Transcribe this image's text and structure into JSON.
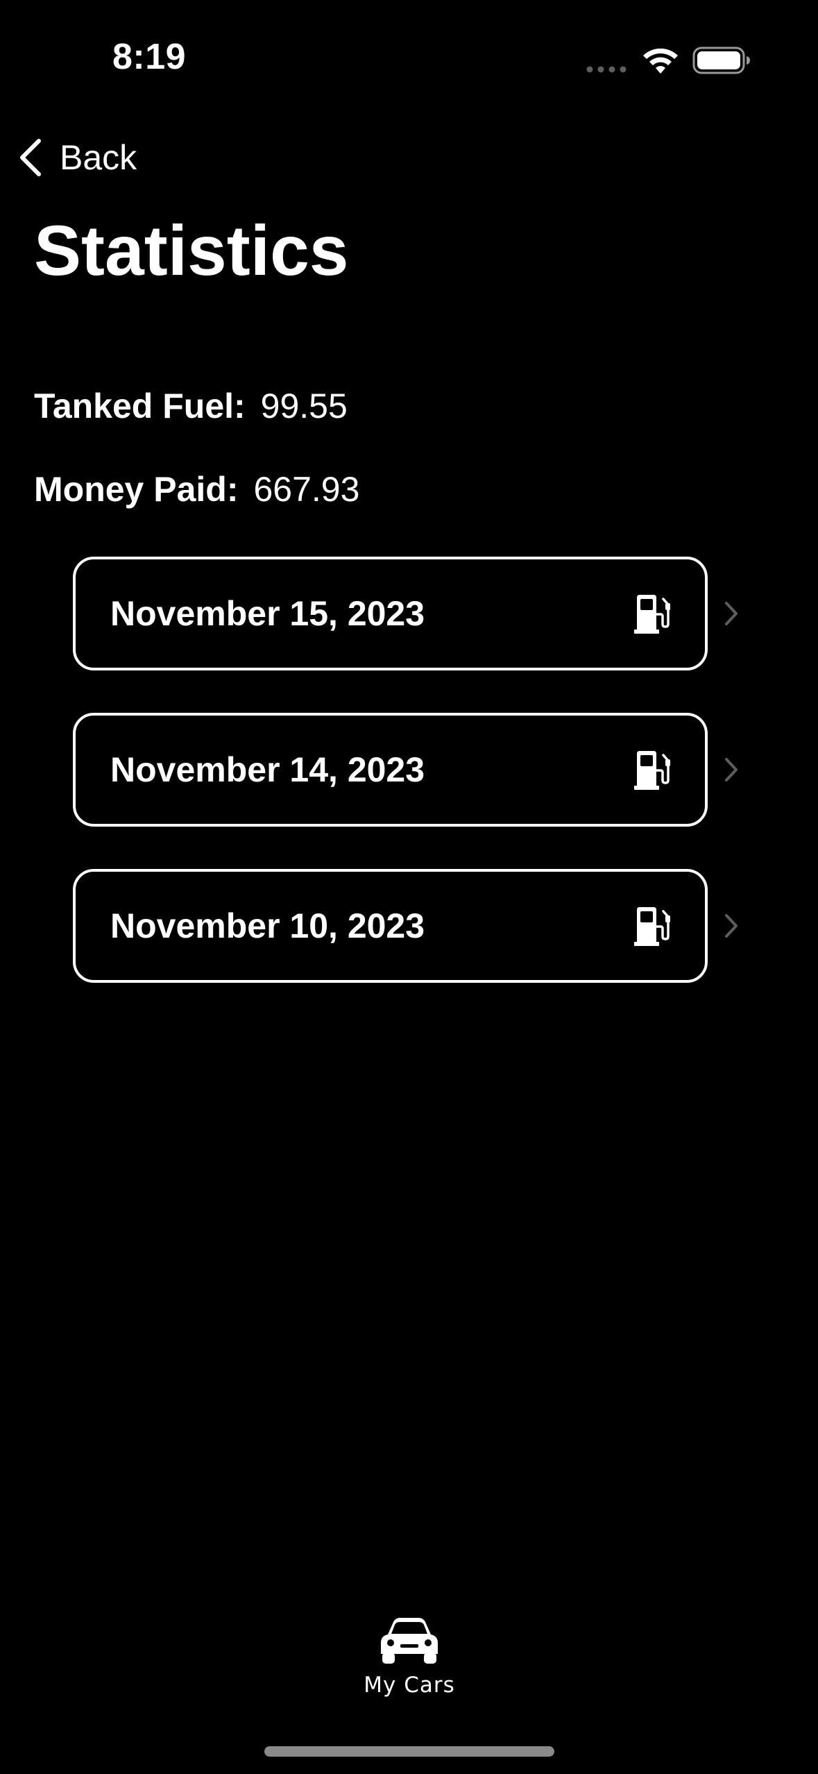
{
  "status_bar": {
    "time": "8:19"
  },
  "nav": {
    "back_label": "Back",
    "title": "Statistics"
  },
  "stats": {
    "tanked_fuel_label": "Tanked Fuel:",
    "tanked_fuel_value": "99.55",
    "money_paid_label": "Money Paid:",
    "money_paid_value": "667.93"
  },
  "entries": [
    {
      "date": "November 15, 2023",
      "icon": "fuel-pump-icon"
    },
    {
      "date": "November 14, 2023",
      "icon": "fuel-pump-icon"
    },
    {
      "date": "November 10, 2023",
      "icon": "fuel-pump-icon"
    }
  ],
  "tab_bar": {
    "items": [
      {
        "label": "My Cars",
        "icon": "car-icon",
        "selected": true
      }
    ]
  },
  "colors": {
    "background": "#000000",
    "foreground": "#ffffff",
    "chevron": "#5e5e5e",
    "home_indicator": "#8a8a8a"
  }
}
